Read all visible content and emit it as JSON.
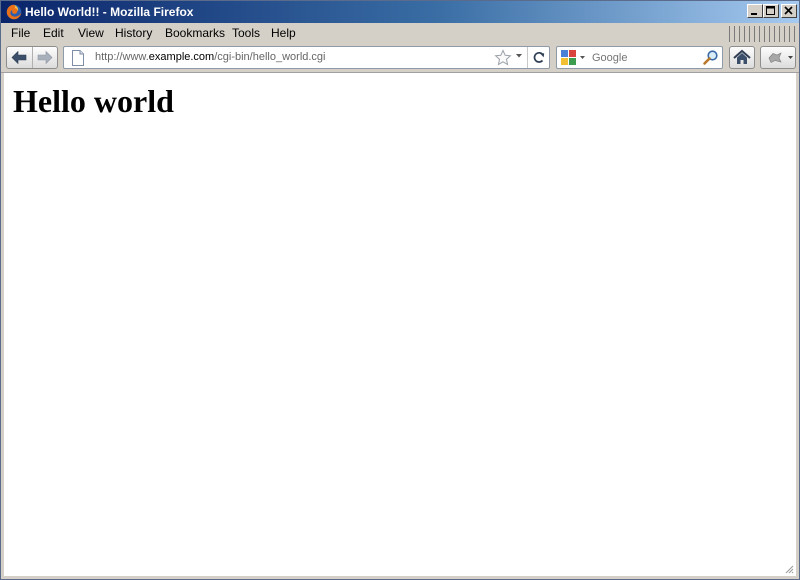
{
  "window": {
    "title": "Hello World!! - Mozilla Firefox",
    "controls": [
      "minimize",
      "maximize",
      "close"
    ]
  },
  "menu": {
    "items": [
      {
        "label": "File"
      },
      {
        "label": "Edit"
      },
      {
        "label": "View"
      },
      {
        "label": "History"
      },
      {
        "label": "Bookmarks"
      },
      {
        "label": "Tools"
      },
      {
        "label": "Help"
      }
    ]
  },
  "navbar": {
    "url": {
      "prefix": "http://www.",
      "domain": "example.com",
      "path": "/cgi-bin/hello_world.cgi"
    },
    "search": {
      "engine": "Google",
      "placeholder": "Google",
      "value": ""
    },
    "icons": [
      "back-icon",
      "forward-icon",
      "page-icon",
      "star-icon",
      "dropdown-icon",
      "reload-icon",
      "google-icon",
      "search-icon",
      "home-icon",
      "addon-icon"
    ]
  },
  "page": {
    "heading": "Hello world"
  },
  "colors": {
    "titlebar_start": "#0a246a",
    "titlebar_end": "#a6caf0",
    "chrome": "#d4d0c8",
    "content_bg": "#ffffff"
  }
}
